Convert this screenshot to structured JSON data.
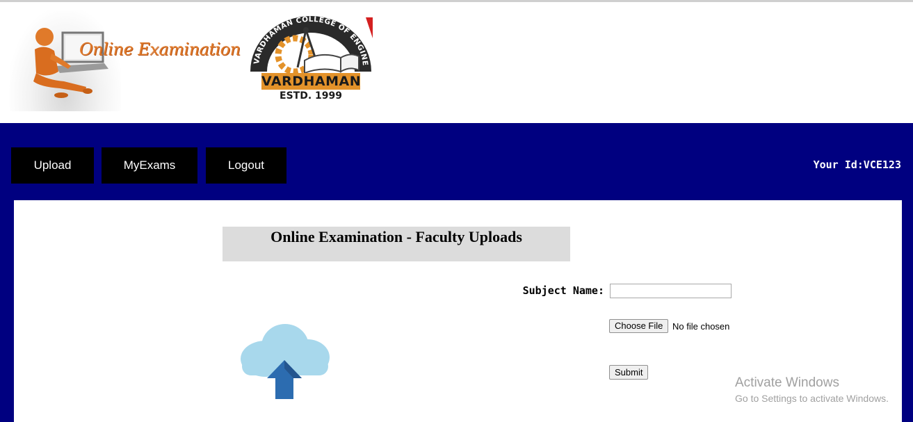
{
  "header": {
    "logo_left": {
      "text": "Online Examination"
    },
    "logo_right": {
      "ring_text": "VARDHAMAN COLLEGE OF ENGINEERING",
      "name": "VARDHAMAN",
      "estd": "ESTD. 1999"
    }
  },
  "nav": {
    "items": [
      {
        "label": "Upload"
      },
      {
        "label": "MyExams"
      },
      {
        "label": "Logout"
      }
    ],
    "user_id": "Your Id:VCE123"
  },
  "main": {
    "title": "Online Examination - Faculty Uploads",
    "form": {
      "subject_label": "Subject Name:",
      "subject_value": "",
      "choose_file_label": "Choose File",
      "file_status": "No file chosen",
      "submit_label": "Submit"
    }
  },
  "watermark": {
    "line1": "Activate Windows",
    "line2": "Go to Settings to activate Windows."
  },
  "colors": {
    "nav_band": "#000080",
    "nav_button": "#000000",
    "title_bg": "#dcdcdc",
    "logo_text": "#e07a2a",
    "cloud": "#a8d8ec",
    "arrow": "#2c6cb0"
  }
}
